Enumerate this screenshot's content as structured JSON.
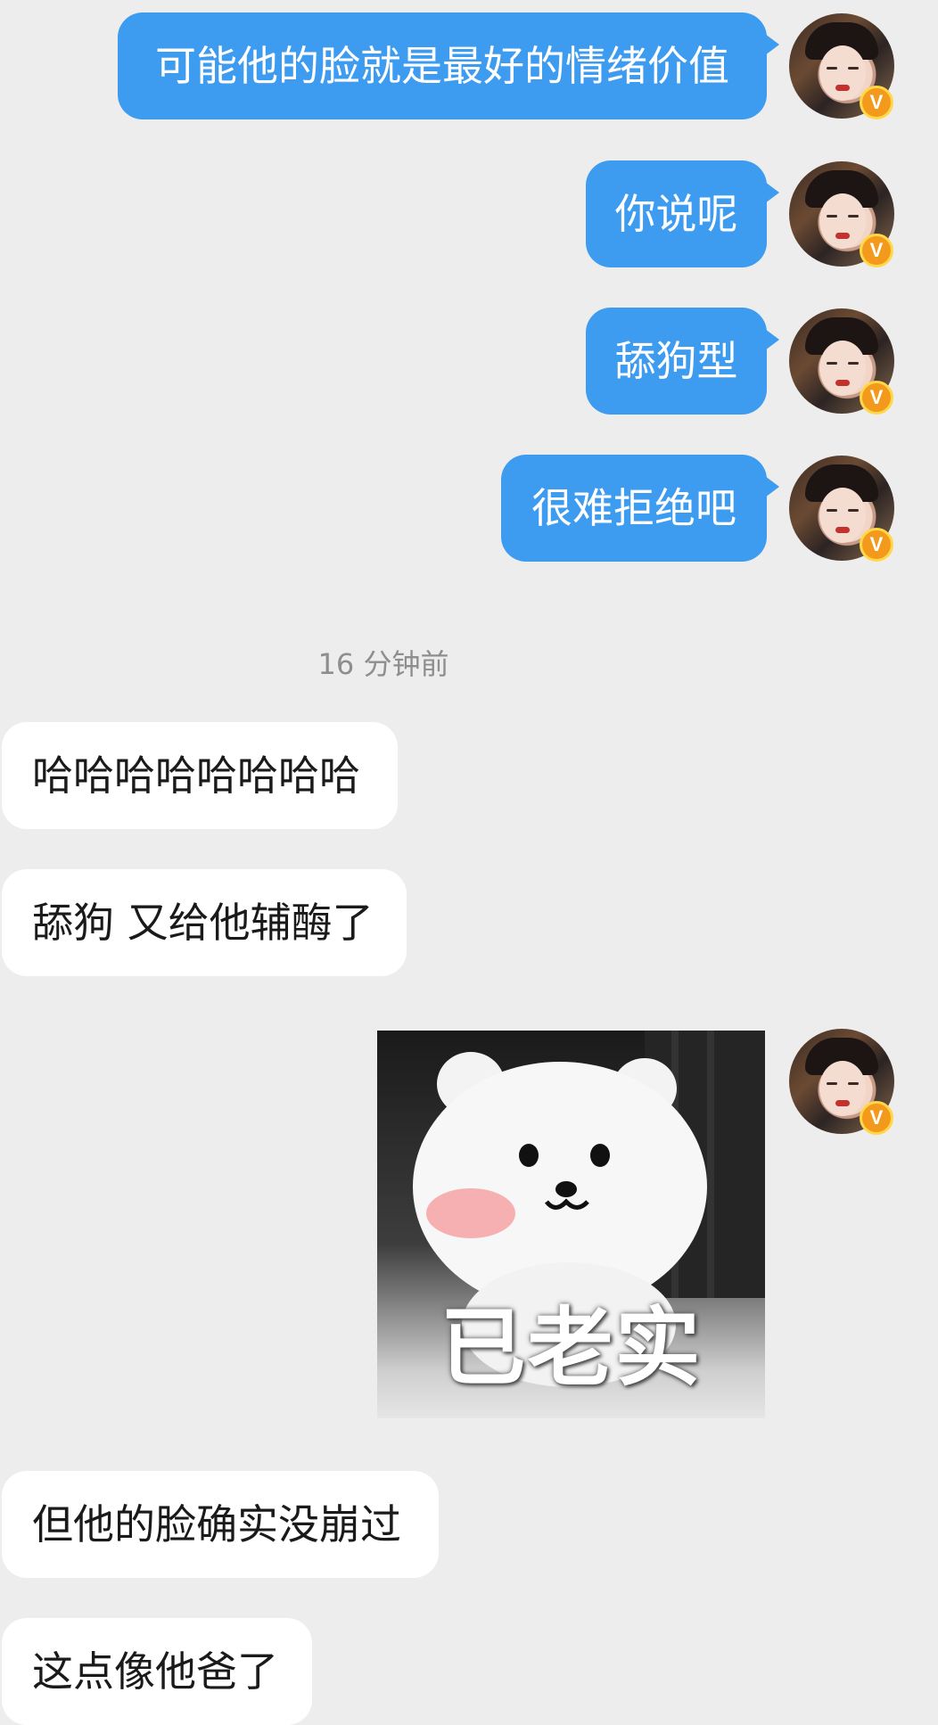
{
  "conversation": {
    "outgoing_top": [
      {
        "text": "可能他的脸就是最好的情绪价值"
      },
      {
        "text": "你说呢"
      },
      {
        "text": "舔狗型"
      },
      {
        "text": "很难拒绝吧"
      }
    ],
    "timestamp": "16 分钟前",
    "incoming_1": [
      {
        "text": "哈哈哈哈哈哈哈哈"
      },
      {
        "text": "舔狗 又给他辅酶了"
      }
    ],
    "sticker": {
      "caption": "已老实",
      "icon": "white-bear-sticker"
    },
    "incoming_2": [
      {
        "text": "但他的脸确实没崩过"
      },
      {
        "text": "这点像他爸了"
      }
    ]
  },
  "avatar": {
    "badge_letter": "V",
    "badge_color": "#f39a1c"
  },
  "colors": {
    "outgoing_bubble": "#3d9bf0",
    "incoming_bubble": "#ffffff",
    "background": "#ededed"
  }
}
